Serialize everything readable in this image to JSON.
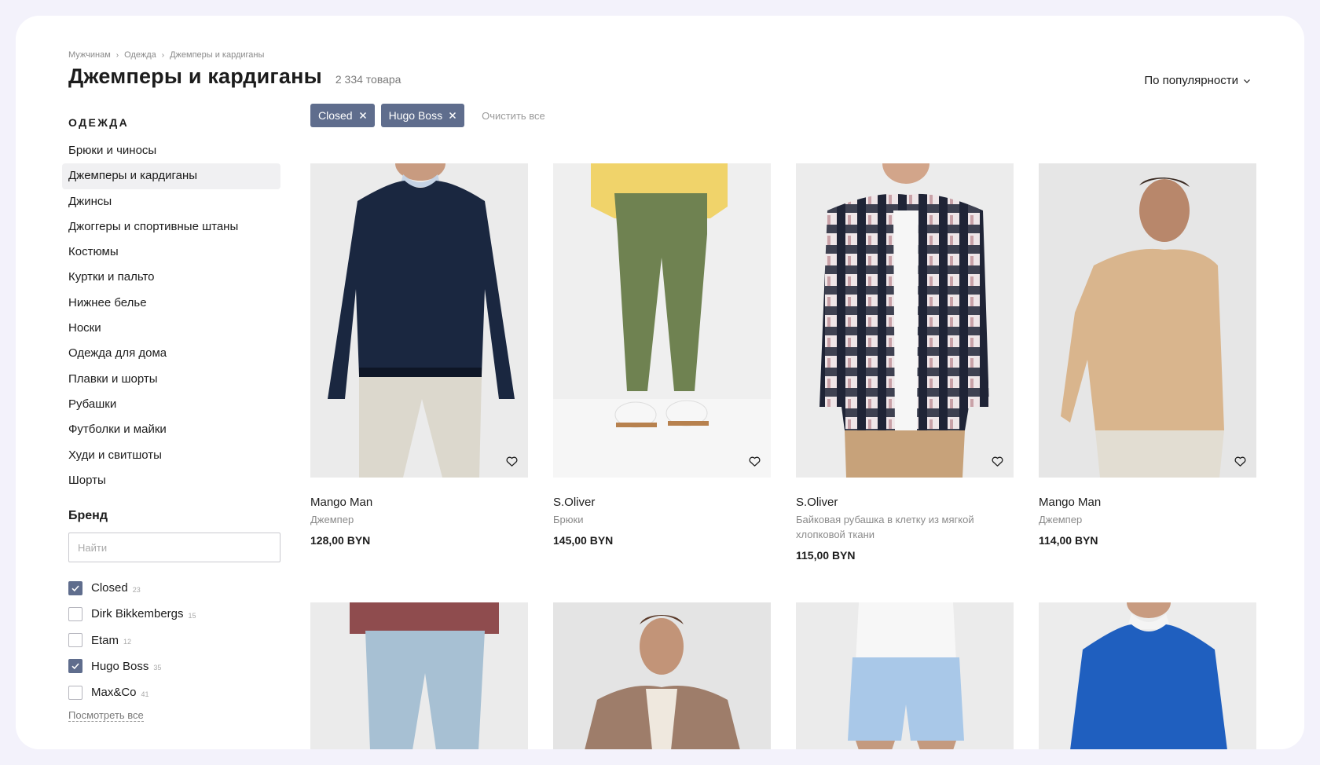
{
  "breadcrumb": [
    "Мужчинам",
    "Одежда",
    "Джемперы и кардиганы"
  ],
  "title": "Джемперы и кардиганы",
  "count": "2 334 товара",
  "sort_label": "По популярности",
  "sidebar": {
    "heading": "ОДЕЖДА",
    "categories": [
      "Брюки и чиносы",
      "Джемперы и кардиганы",
      "Джинсы",
      "Джоггеры и спортивные штаны",
      "Костюмы",
      "Куртки и пальто",
      "Нижнее белье",
      "Носки",
      "Одежда для дома",
      "Плавки и шорты",
      "Рубашки",
      "Футболки и майки",
      "Худи и свитшоты",
      "Шорты"
    ],
    "active_category": "Джемперы и кардиганы"
  },
  "brand_filter": {
    "heading": "Бренд",
    "search_placeholder": "Найти",
    "brands": [
      {
        "name": "Closed",
        "count": "23",
        "checked": true
      },
      {
        "name": "Dirk Bikkembergs",
        "count": "15",
        "checked": false
      },
      {
        "name": "Etam",
        "count": "12",
        "checked": false
      },
      {
        "name": "Hugo Boss",
        "count": "35",
        "checked": true
      },
      {
        "name": "Max&Co",
        "count": "41",
        "checked": false
      }
    ],
    "see_all": "Посмотреть все"
  },
  "active_filters": [
    "Closed",
    "Hugo Boss"
  ],
  "clear_all": "Очистить все",
  "products": [
    {
      "brand": "Mango Man",
      "type": "Джемпер",
      "price": "128,00 BYN",
      "image": "navy-sweater-light-chinos"
    },
    {
      "brand": "S.Oliver",
      "type": "Брюки",
      "price": "145,00 BYN",
      "image": "olive-chinos-white-sneakers"
    },
    {
      "brand": "S.Oliver",
      "type": "Байковая рубашка в клетку из мягкой хлопковой ткани",
      "price": "115,00 BYN",
      "image": "plaid-flannel-shirt"
    },
    {
      "brand": "Mango Man",
      "type": "Джемпер",
      "price": "114,00 BYN",
      "image": "beige-sweater"
    },
    {
      "image": "light-blue-jeans"
    },
    {
      "image": "linen-blazer"
    },
    {
      "image": "light-blue-shorts"
    },
    {
      "image": "blue-sweater"
    }
  ],
  "colors": {
    "accent": "#5f6d8d",
    "background": "#f3f2fb"
  }
}
